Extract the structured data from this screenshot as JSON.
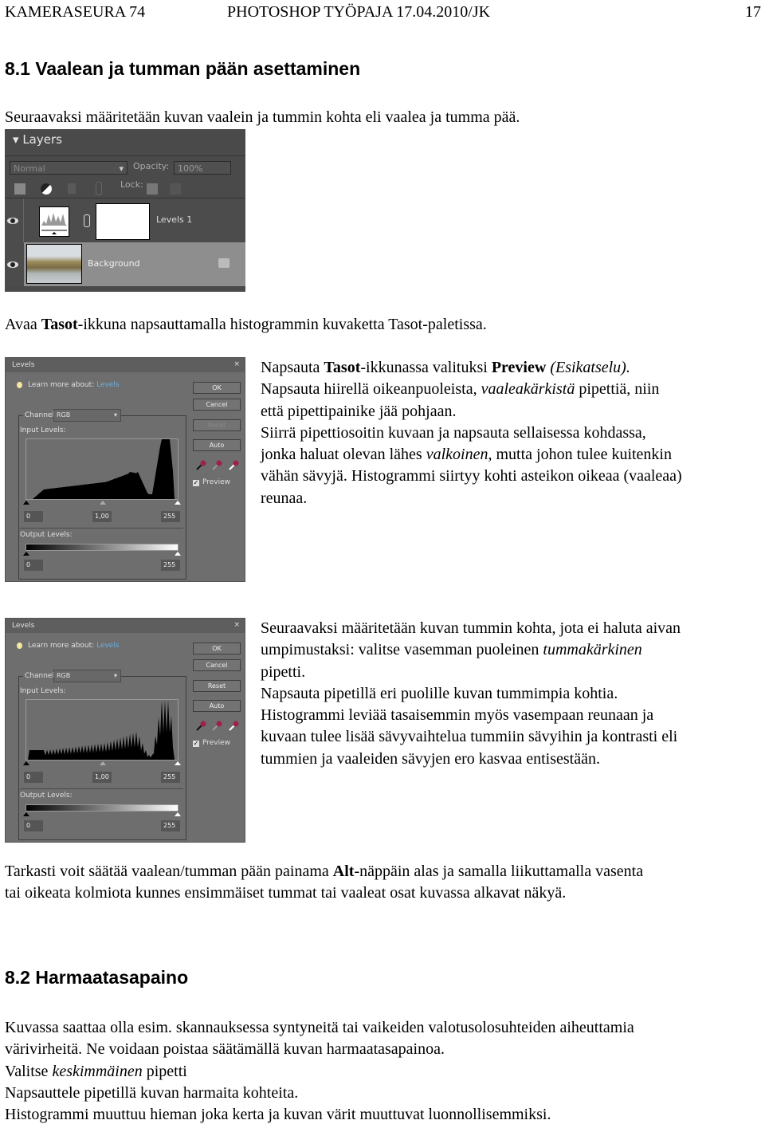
{
  "header": {
    "left": "KAMERASEURA 74",
    "center": "PHOTOSHOP TYÖPAJA 17.04.2010/JK",
    "page": "17"
  },
  "section1": {
    "title": "8.1 Vaalean ja tumman pään asettaminen",
    "intro": [
      [
        {
          "t": "Seuraavaksi määritetään kuvan vaalein ja tummin kohta eli vaalea ja tumma pää."
        }
      ]
    ],
    "layers_text": [
      [
        {
          "t": "Avaa "
        },
        {
          "t": "Tasot",
          "s": "b"
        },
        {
          "t": "-ikkuna napsauttamalla histogrammin kuvaketta  Tasot-paletissa."
        }
      ]
    ],
    "step1": [
      [
        {
          "t": "Napsauta "
        },
        {
          "t": "Tasot",
          "s": "b"
        },
        {
          "t": "-ikkunassa valituksi "
        },
        {
          "t": "Preview",
          "s": "b"
        },
        {
          "t": " (Esikatselu).",
          "s": "i"
        }
      ],
      [
        {
          "t": "Napsauta hiirellä oikeanpuoleista, "
        },
        {
          "t": "vaaleakärkistä",
          "s": "i"
        },
        {
          "t": " pipettiä, niin"
        }
      ],
      [
        {
          "t": "että pipettipainike jää pohjaan."
        }
      ],
      [
        {
          "t": "Siirrä pipettiosoitin kuvaan ja napsauta sellaisessa kohdassa,"
        }
      ],
      [
        {
          "t": "jonka haluat olevan lähes "
        },
        {
          "t": "valkoinen",
          "s": "i"
        },
        {
          "t": ", mutta johon tulee kuitenkin"
        }
      ],
      [
        {
          "t": "vähän sävyjä. Histogrammi siirtyy kohti asteikon oikeaa (vaaleaa)"
        }
      ],
      [
        {
          "t": "reunaa."
        }
      ]
    ],
    "step2": [
      [
        {
          "t": "Seuraavaksi määritetään kuvan tummin kohta, jota ei haluta aivan"
        }
      ],
      [
        {
          "t": "umpimustaksi: valitse vasemman puoleinen "
        },
        {
          "t": "tummakärkinen",
          "s": "i"
        }
      ],
      [
        {
          "t": "pipetti."
        }
      ],
      [
        {
          "t": "Napsauta pipetillä eri puolille kuvan tummimpia kohtia."
        }
      ],
      [
        {
          "t": "Histogrammi leviää tasaisemmin myös vasempaan reunaan ja"
        }
      ],
      [
        {
          "t": "kuvaan tulee lisää sävyvaihtelua tummiin sävyihin ja kontrasti eli"
        }
      ],
      [
        {
          "t": "tummien ja vaaleiden sävyjen ero kasvaa entisestään."
        }
      ]
    ],
    "alt": [
      [
        {
          "t": "Tarkasti voit säätää vaalean/tumman pään painama "
        },
        {
          "t": "Alt",
          "s": "b"
        },
        {
          "t": "-näppäin alas ja samalla liikuttamalla vasenta"
        }
      ],
      [
        {
          "t": "tai oikeata kolmiota kunnes ensimmäiset tummat tai vaaleat osat kuvassa alkavat näkyä."
        }
      ]
    ]
  },
  "section2": {
    "title": "8.2 Harmaatasapaino",
    "body": [
      [
        {
          "t": "Kuvassa saattaa olla esim. skannauksessa syntyneitä tai vaikeiden valotusolosuhteiden aiheuttamia"
        }
      ],
      [
        {
          "t": "värivirheitä. Ne voidaan poistaa säätämällä kuvan harmaatasapainoa."
        }
      ],
      [
        {
          "t": "Valitse "
        },
        {
          "t": "keskimmäinen",
          "s": "i"
        },
        {
          "t": " pipetti"
        }
      ],
      [
        {
          "t": "Napsauttele pipetillä kuvan harmaita kohteita."
        }
      ],
      [
        {
          "t": "Histogrammi muuttuu hieman joka kerta ja kuvan värit muuttuvat luonnollisemmiksi."
        }
      ]
    ]
  },
  "layers_panel": {
    "title": "Layers",
    "blend": "Normal",
    "opacity_label": "Opacity:",
    "opacity": "100%",
    "lock_label": "Lock:",
    "layers": [
      {
        "name": "Levels 1"
      },
      {
        "name": "Background"
      }
    ]
  },
  "levels": {
    "title": "Levels",
    "close": "×",
    "learn": "Learn more about:",
    "learn_link": "Levels",
    "ok": "OK",
    "cancel": "Cancel",
    "reset": "Reset",
    "auto": "Auto",
    "preview": "Preview",
    "channel_label": "Channel:",
    "channel": "RGB",
    "input_label": "Input Levels:",
    "output_label": "Output Levels:",
    "in_black": "0",
    "in_gamma": "1,00",
    "in_white": "255",
    "out_black": "0",
    "out_white": "255",
    "link_color": "#6ab0e0",
    "check": "✓"
  }
}
